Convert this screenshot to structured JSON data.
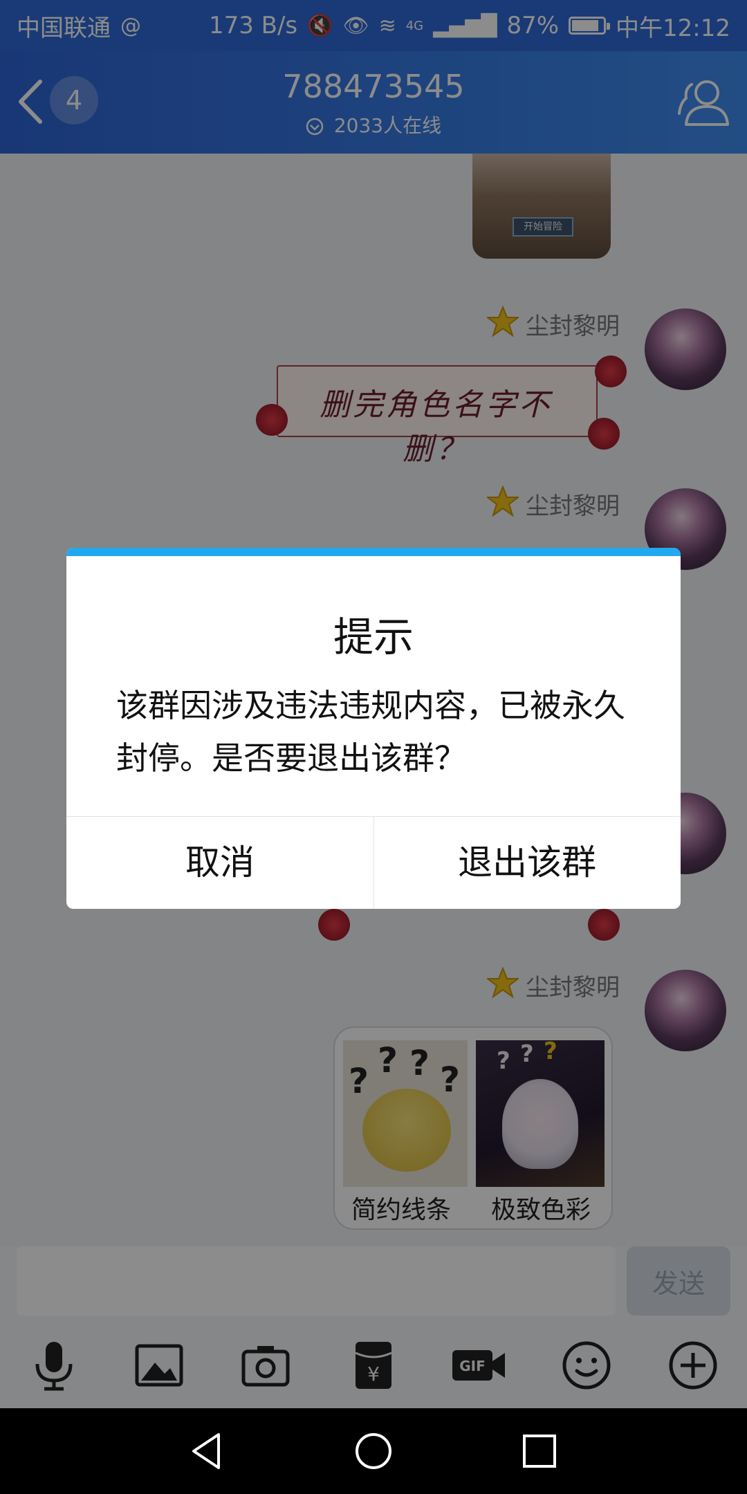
{
  "status_bar": {
    "carrier": "中国联通",
    "net_speed": "173 B/s",
    "signal_type": "4G",
    "battery_percent": "87%",
    "battery_level": 0.87,
    "time": "中午12:12"
  },
  "header": {
    "back_count": "4",
    "title": "788473545",
    "online": "2033人在线"
  },
  "chat": {
    "card_button": "开始冒险",
    "messages": [
      {
        "sender": "尘封黎明",
        "sticker_text": "删完角色名字不删？"
      },
      {
        "sender": "尘封黎明"
      },
      {
        "sender": "尘封黎明"
      },
      {
        "sender": "尘封黎明",
        "options": [
          "简约线条",
          "极致色彩"
        ]
      }
    ]
  },
  "input": {
    "value": "",
    "placeholder": "",
    "send_label": "发送"
  },
  "toolbar": {
    "icons": [
      "microphone-icon",
      "image-icon",
      "camera-icon",
      "red-packet-icon",
      "gif-icon",
      "emoji-icon",
      "plus-icon"
    ]
  },
  "dialog": {
    "title": "提示",
    "message": "该群因涉及违法违规内容，已被永久封停。是否要退出该群？",
    "cancel_label": "取消",
    "confirm_label": "退出该群"
  },
  "colors": {
    "header_blue": "#2e6ad8",
    "dialog_accent": "#21a9f0",
    "star_gold": "#f3c21b"
  }
}
